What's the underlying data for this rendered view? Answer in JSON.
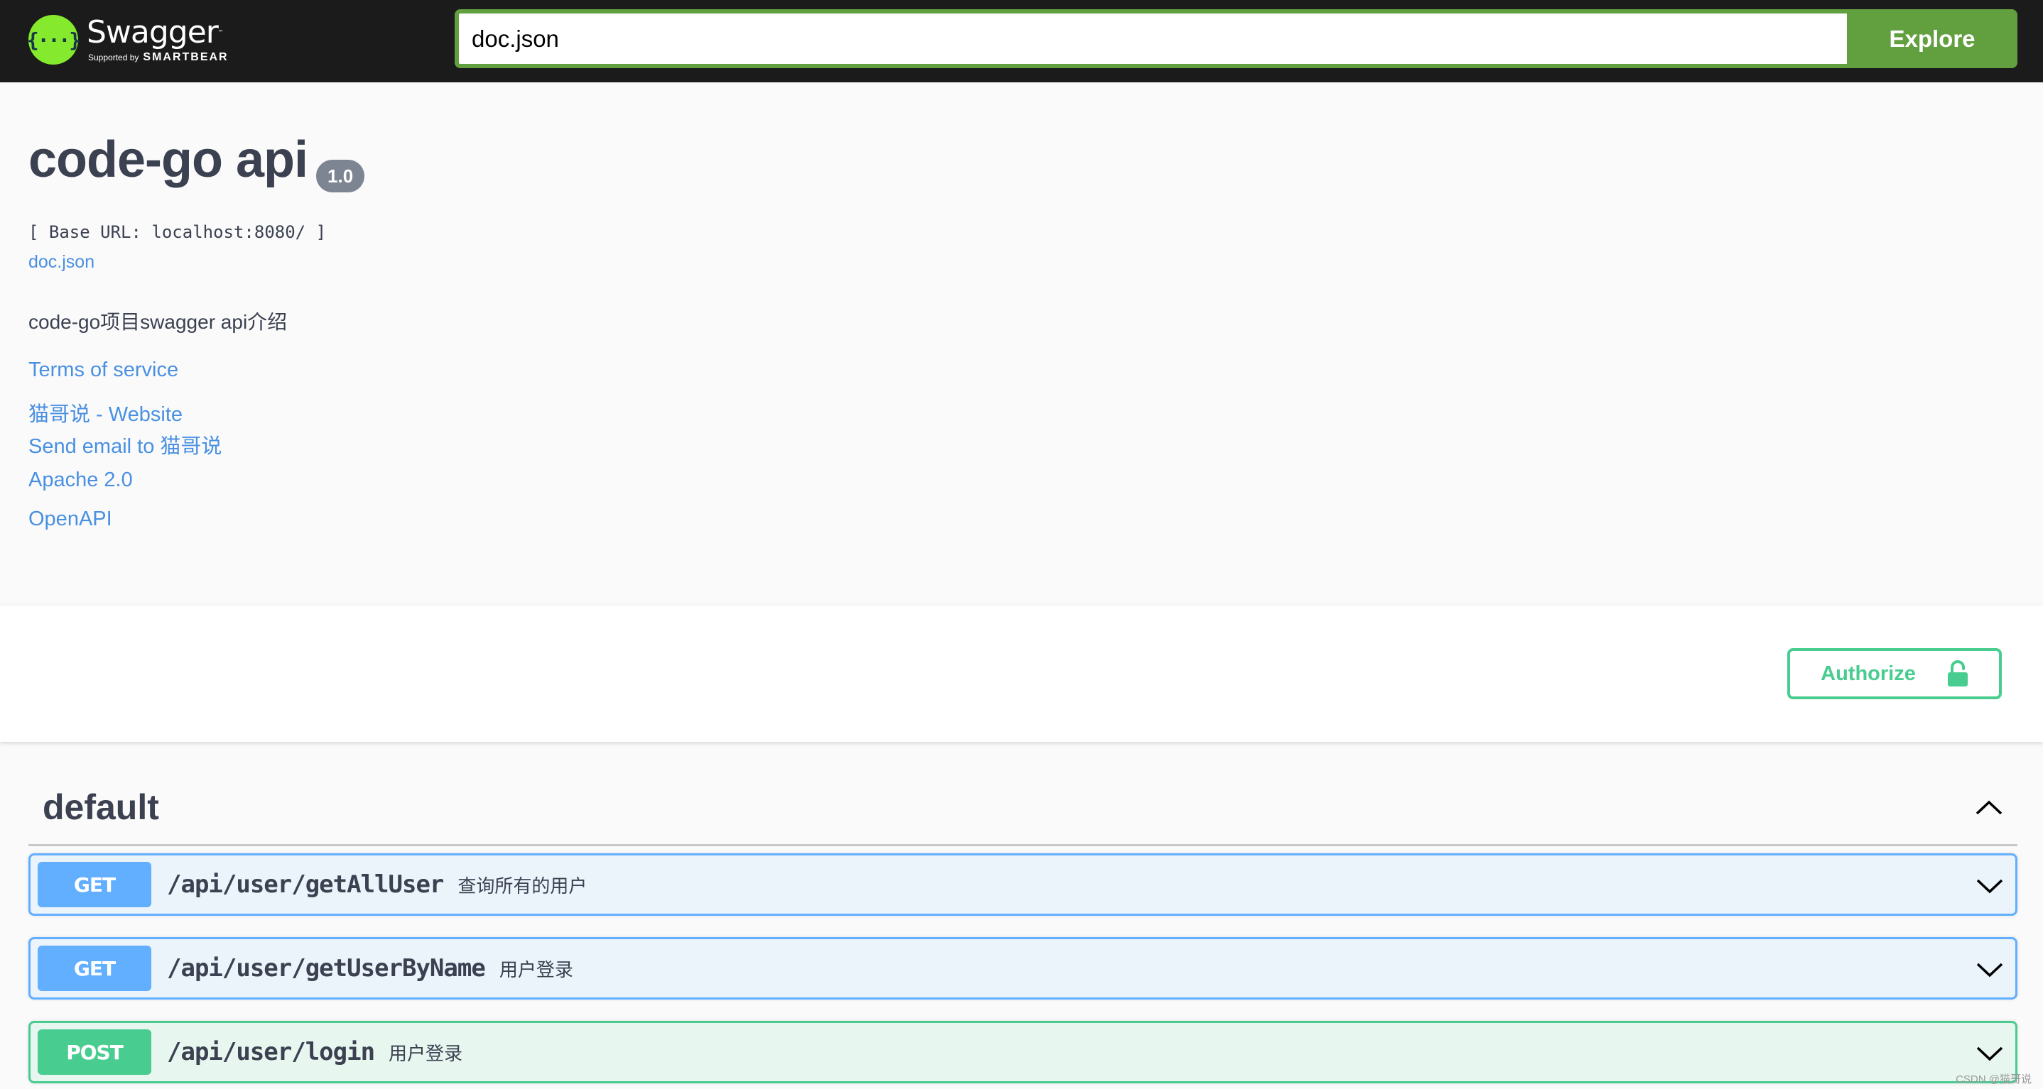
{
  "topbar": {
    "logo": {
      "icon": "swagger-braces-icon",
      "glyph": "{···}",
      "name": "Swagger",
      "tm": "™",
      "supported_by": "Supported by",
      "brand": "SMARTBEAR"
    },
    "url_input": {
      "value": "doc.json"
    },
    "explore_label": "Explore"
  },
  "info": {
    "title": "code-go api",
    "version": "1.0",
    "base_url": "[ Base URL: localhost:8080/ ]",
    "spec_link": "doc.json",
    "description": "code-go项目swagger api介绍",
    "terms_of_service": "Terms of service",
    "contact_website": "猫哥说 - Website",
    "contact_email": "Send email to 猫哥说",
    "license": "Apache 2.0",
    "external_docs": "OpenAPI"
  },
  "scheme": {
    "authorize_label": "Authorize",
    "authorize_icon": "unlocked-padlock-icon"
  },
  "tags": [
    {
      "name": "default",
      "expanded": true,
      "operations": [
        {
          "method": "GET",
          "path": "/api/user/getAllUser",
          "summary": "查询所有的用户"
        },
        {
          "method": "GET",
          "path": "/api/user/getUserByName",
          "summary": "用户登录"
        },
        {
          "method": "POST",
          "path": "/api/user/login",
          "summary": "用户登录"
        }
      ]
    }
  ],
  "colors": {
    "topbar_bg": "#1b1b1b",
    "explore_green": "#62a03f",
    "logo_green": "#85ea2d",
    "link_blue": "#4990e2",
    "get_blue": "#61affe",
    "post_green": "#49cc90",
    "text_dark": "#3b4151",
    "version_badge": "#7d8492"
  },
  "watermark": "CSDN @猫哥说"
}
